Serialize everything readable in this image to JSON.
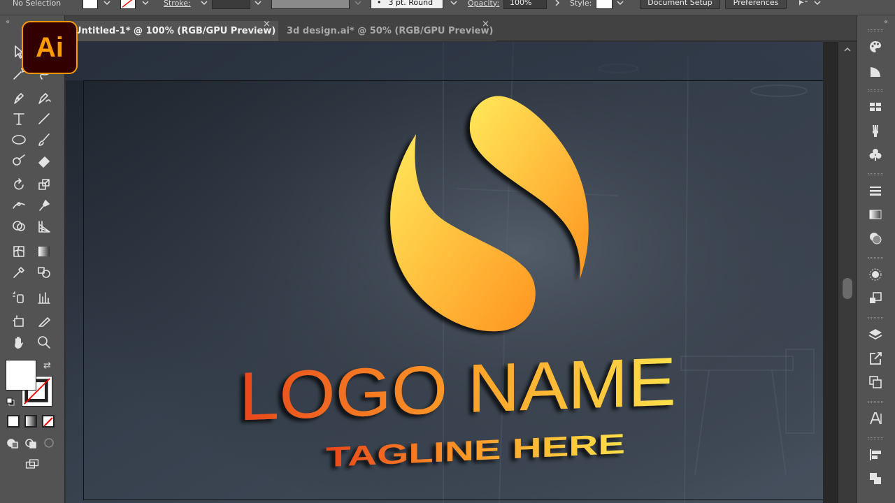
{
  "control_bar": {
    "selection_status": "No Selection",
    "stroke_label": "Stroke:",
    "brush_profile": "3 pt. Round",
    "opacity_label": "Opacity:",
    "opacity_value": "100%",
    "style_label": "Style:",
    "document_setup_label": "Document Setup",
    "preferences_label": "Preferences"
  },
  "app": {
    "logo_text": "Ai",
    "brand_color": "#ff9a00"
  },
  "tabs": [
    {
      "label": "Untitled-1* @ 100% (RGB/GPU Preview)",
      "close": "×"
    },
    {
      "label": "3d design.ai* @ 50% (RGB/GPU Preview)",
      "close": "×"
    }
  ],
  "panels": {
    "collapse_left": "«",
    "collapse_right": "«"
  },
  "artwork": {
    "logo_name": "LOGO NAME",
    "tagline": "TAGLINE HERE",
    "gradient_start": "#ffd84a",
    "gradient_end": "#ff8a1c",
    "text_gradient_start": "#e0401a",
    "text_gradient_end": "#ffd84a",
    "wall_color": "#3a4452"
  },
  "tools": [
    "selection-tool",
    "direct-selection-tool",
    "magic-wand-tool",
    "lasso-tool",
    "pen-tool",
    "curvature-tool",
    "type-tool",
    "line-segment-tool",
    "ellipse-tool",
    "paintbrush-tool",
    "shaper-tool",
    "eraser-tool",
    "rotate-tool",
    "scale-tool",
    "width-tool",
    "puppet-warp-tool",
    "shape-builder-tool",
    "perspective-grid-tool",
    "mesh-tool",
    "gradient-tool",
    "eyedropper-tool",
    "blend-tool",
    "symbol-sprayer-tool",
    "column-graph-tool",
    "artboard-tool",
    "slice-tool",
    "hand-tool",
    "zoom-tool"
  ]
}
